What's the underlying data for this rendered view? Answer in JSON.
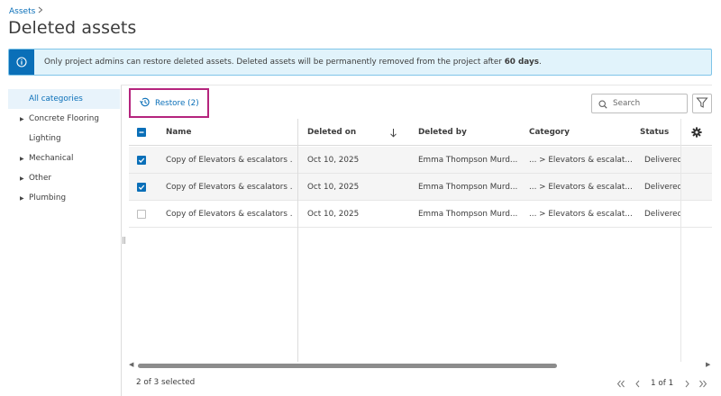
{
  "breadcrumb": {
    "parent": "Assets"
  },
  "page": {
    "title": "Deleted assets"
  },
  "banner": {
    "text_before": "Only project admins can restore deleted assets. Deleted assets will be permanently removed from the project after ",
    "text_bold": "60 days",
    "text_after": "."
  },
  "sidebar": {
    "items": [
      {
        "label": "All categories",
        "expandable": false,
        "active": true
      },
      {
        "label": "Concrete Flooring",
        "expandable": true,
        "active": false
      },
      {
        "label": "Lighting",
        "expandable": false,
        "active": false
      },
      {
        "label": "Mechanical",
        "expandable": true,
        "active": false
      },
      {
        "label": "Other",
        "expandable": true,
        "active": false
      },
      {
        "label": "Plumbing",
        "expandable": true,
        "active": false
      }
    ]
  },
  "toolbar": {
    "restore_label": "Restore (2)",
    "search_placeholder": "Search"
  },
  "table": {
    "columns": {
      "name": "Name",
      "deleted_on": "Deleted on",
      "deleted_by": "Deleted by",
      "category": "Category",
      "status": "Status"
    },
    "rows": [
      {
        "checked": true,
        "name": "Copy of Elevators & escalators ...",
        "deleted_on": "Oct 10, 2025",
        "deleted_by": "Emma Thompson Murd...",
        "category": "... > Elevators & escalat...",
        "status": "Delivered"
      },
      {
        "checked": true,
        "name": "Copy of Elevators & escalators ...",
        "deleted_on": "Oct 10, 2025",
        "deleted_by": "Emma Thompson Murd...",
        "category": "... > Elevators & escalat...",
        "status": "Delivered"
      },
      {
        "checked": false,
        "name": "Copy of Elevators & escalators ...",
        "deleted_on": "Oct 10, 2025",
        "deleted_by": "Emma Thompson Murd...",
        "category": "... > Elevators & escalat...",
        "status": "Delivered"
      }
    ]
  },
  "footer": {
    "selected_text": "2 of 3 selected",
    "page_text": "1 of 1"
  },
  "colors": {
    "accent": "#0a6fb8",
    "highlight_border": "#b5247d",
    "status_delivered": "#7b3fd6"
  }
}
